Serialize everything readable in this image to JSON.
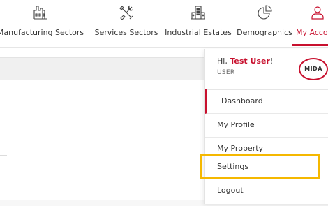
{
  "nav": {
    "items": [
      {
        "label": "Manufacturing Sectors",
        "icon": "factory-icon"
      },
      {
        "label": "Services Sectors",
        "icon": "tools-icon"
      },
      {
        "label": "Industrial Estates",
        "icon": "buildings-icon"
      },
      {
        "label": "Demographics",
        "icon": "pie-chart-icon"
      },
      {
        "label": "My Account",
        "icon": "user-icon",
        "active": true
      }
    ]
  },
  "account_menu": {
    "greeting_prefix": "Hi, ",
    "user_name": "Test User",
    "greeting_suffix": "!",
    "role": "USER",
    "logo_text": "MIDA",
    "items": [
      {
        "label": "Dashboard",
        "active": true
      },
      {
        "label": "My Profile"
      },
      {
        "label": "My Property"
      },
      {
        "label": "Settings",
        "highlighted": true
      },
      {
        "label": "Logout"
      }
    ]
  },
  "colors": {
    "accent": "#c8102e",
    "highlight": "#f5b800"
  }
}
